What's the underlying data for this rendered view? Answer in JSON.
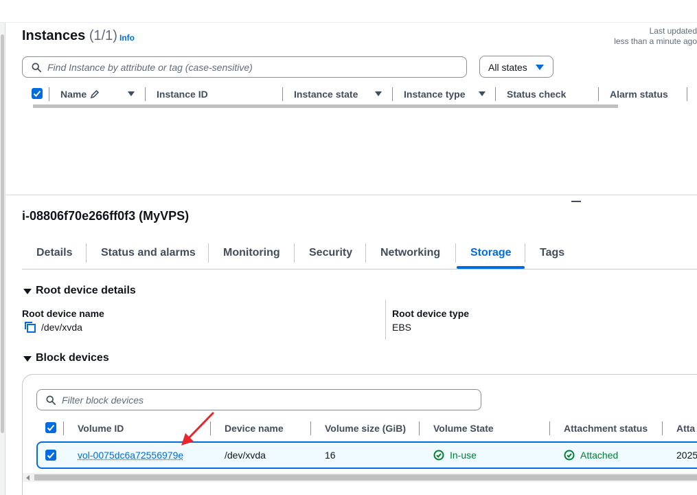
{
  "header": {
    "title": "Instances",
    "count": "(1/1)",
    "info_label": "Info",
    "last_updated_line1": "Last updated",
    "last_updated_line2": "less than a minute ago"
  },
  "search": {
    "placeholder": "Find Instance by attribute or tag (case-sensitive)"
  },
  "state_filter": {
    "selected": "All states"
  },
  "instances_table": {
    "columns": [
      "Name",
      "Instance ID",
      "Instance state",
      "Instance type",
      "Status check",
      "Alarm status"
    ]
  },
  "details_panel": {
    "instance_title": "i-08806f70e266ff0f3 (MyVPS)",
    "tabs": [
      "Details",
      "Status and alarms",
      "Monitoring",
      "Security",
      "Networking",
      "Storage",
      "Tags"
    ],
    "active_tab": "Storage"
  },
  "root_device": {
    "section_title": "Root device details",
    "name_label": "Root device name",
    "name_value": "/dev/xvda",
    "type_label": "Root device type",
    "type_value": "EBS"
  },
  "block_devices": {
    "section_title": "Block devices",
    "filter_placeholder": "Filter block devices",
    "columns": [
      "Volume ID",
      "Device name",
      "Volume size (GiB)",
      "Volume State",
      "Attachment status",
      "Atta"
    ],
    "rows": [
      {
        "volume_id": "vol-0075dc6a72556979e",
        "device_name": "/dev/xvda",
        "size": "16",
        "state": "In-use",
        "attachment": "Attached",
        "attach_time": "2025"
      }
    ]
  },
  "colors": {
    "accent": "#006ce0",
    "success": "#00802f",
    "annotation_arrow": "#e8262b"
  }
}
